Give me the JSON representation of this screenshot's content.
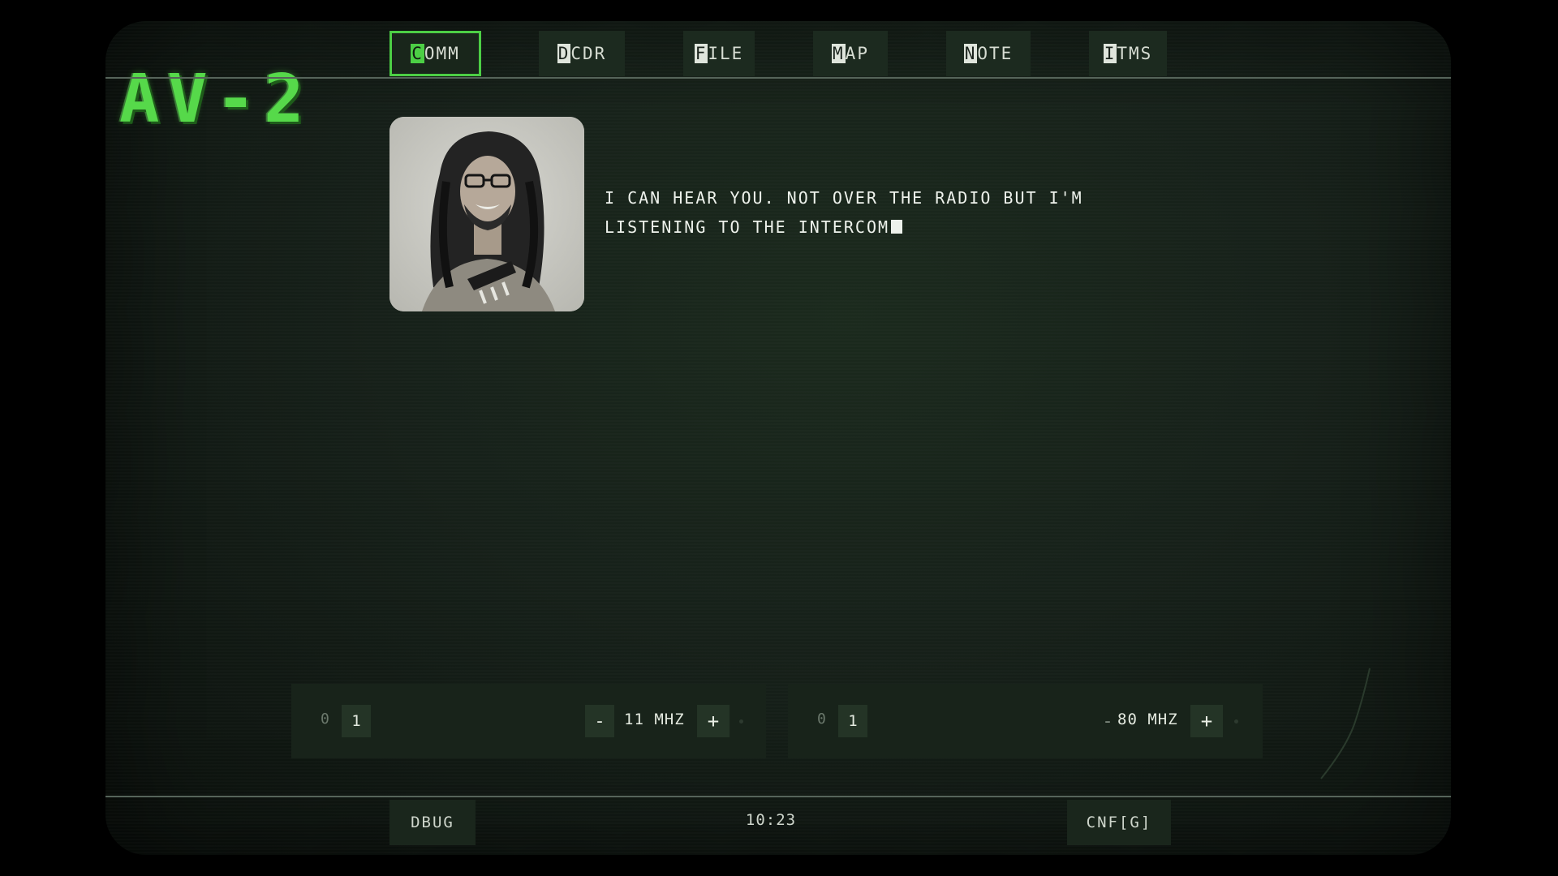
{
  "app": {
    "logo": "AV-2"
  },
  "tabs": [
    {
      "key": "C",
      "rest": "OMM",
      "active": true
    },
    {
      "key": "D",
      "rest": "CDR",
      "active": false
    },
    {
      "key": "F",
      "rest": "ILE",
      "active": false
    },
    {
      "key": "M",
      "rest": "AP",
      "active": false
    },
    {
      "key": "N",
      "rest": "OTE",
      "active": false
    },
    {
      "key": "I",
      "rest": "TMS",
      "active": false
    }
  ],
  "dialog": {
    "text": "I CAN HEAR YOU. NOT OVER THE RADIO BUT I'M LISTENING TO THE INTERCOM"
  },
  "channels": [
    {
      "bit_off": "0",
      "bit_on": "1",
      "minus": "-",
      "frequency": "11 MHZ",
      "plus": "+"
    },
    {
      "bit_off": "0",
      "bit_on": "1",
      "minus": "-",
      "frequency": "80 MHZ",
      "plus": "+"
    }
  ],
  "footer": {
    "debug_label": "DBUG",
    "time": "10:23",
    "config_label": "CNF[G]"
  },
  "colors": {
    "accent": "#4ccf45",
    "background": "#162019",
    "text": "#dfe6dc"
  },
  "icons": {
    "portrait": "speaker-portrait"
  }
}
